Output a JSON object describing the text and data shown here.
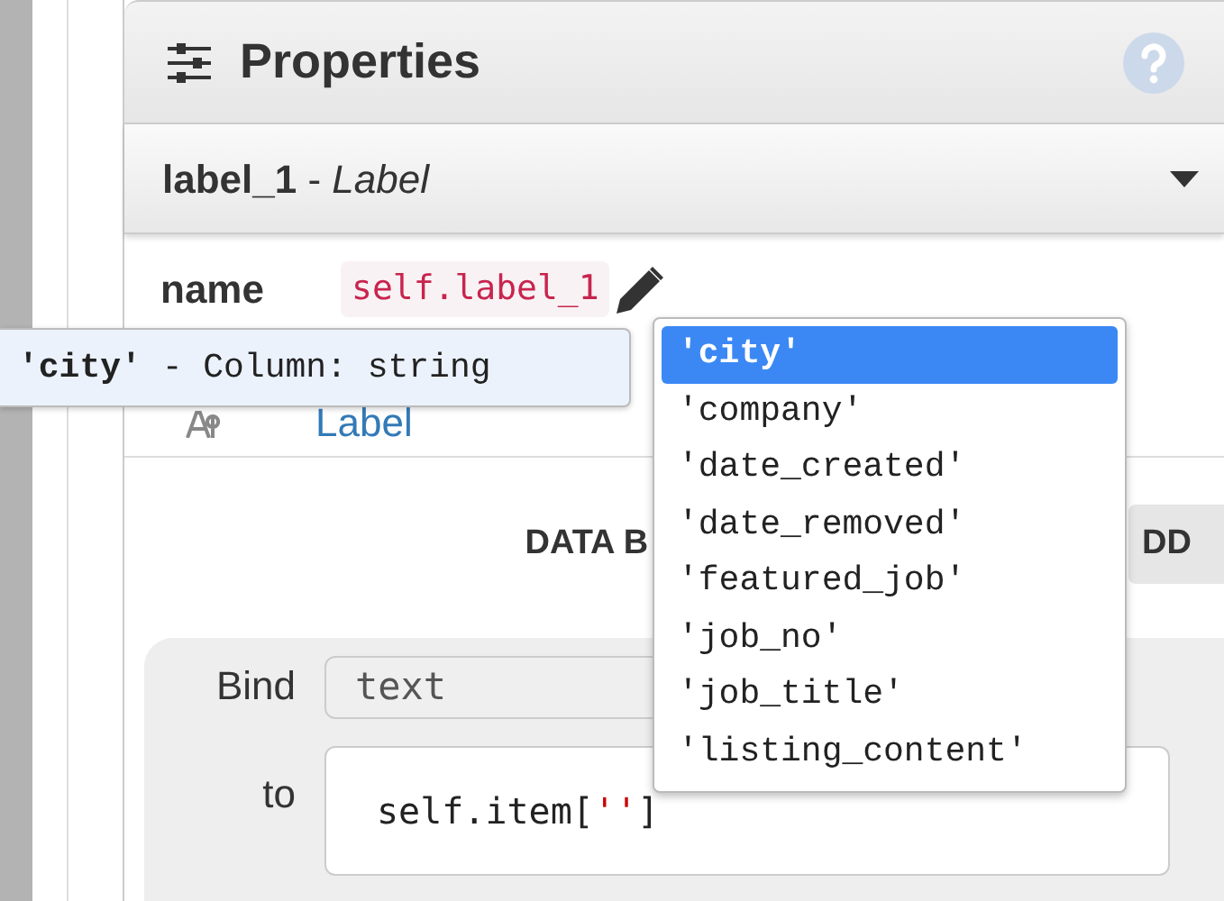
{
  "panel": {
    "title": "Properties"
  },
  "component": {
    "title": "**label_1** - *Label*"
  },
  "name_row": {
    "label": "name",
    "value": "self.label_1"
  },
  "text_row": {
    "value": "Label"
  },
  "data_bindings": {
    "heading": "DATA B",
    "add_button": "DD"
  },
  "binding": {
    "bind_label": "Bind",
    "property": "text",
    "to_label": "to",
    "code_prefix": "self.item[",
    "code_string": "''",
    "code_suffix": "]"
  },
  "tooltip": {
    "text": "**'city'** - Column: string"
  },
  "autocomplete": [
    {
      "label": "'city'",
      "selected": true
    },
    {
      "label": "'company'",
      "selected": false
    },
    {
      "label": "'date_created'",
      "selected": false
    },
    {
      "label": "'date_removed'",
      "selected": false
    },
    {
      "label": "'featured_job'",
      "selected": false
    },
    {
      "label": "'job_no'",
      "selected": false
    },
    {
      "label": "'job_title'",
      "selected": false
    },
    {
      "label": "'listing_content'",
      "selected": false
    }
  ]
}
